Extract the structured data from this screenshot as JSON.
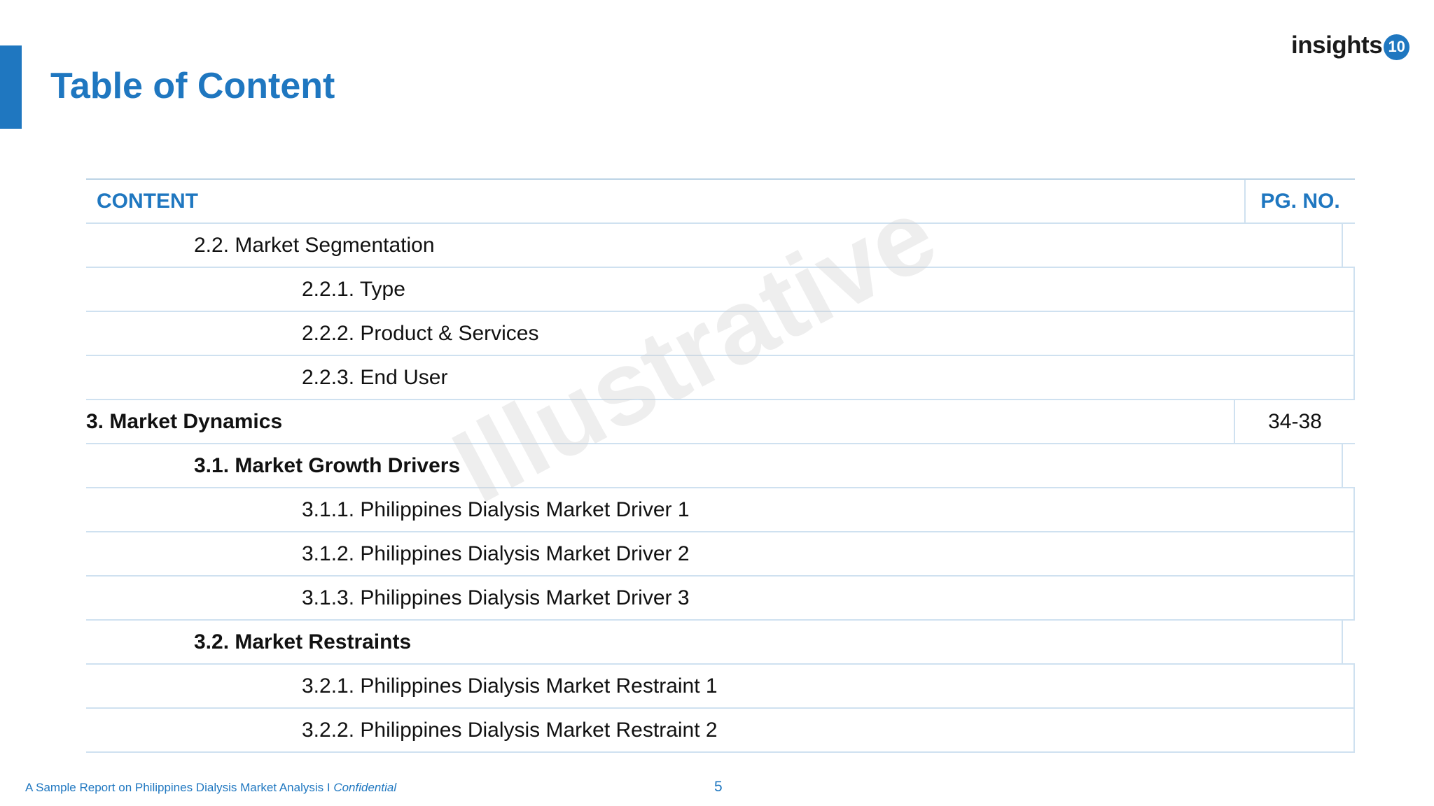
{
  "page": {
    "title": "Table of Content",
    "logo_text": "insights",
    "logo_badge": "10",
    "watermark": "Illustrative"
  },
  "table": {
    "header": {
      "content": "CONTENT",
      "page": "PG. NO."
    },
    "rows": [
      {
        "text": "2.2. Market Segmentation",
        "page": ""
      },
      {
        "text": "2.2.1. Type",
        "page": ""
      },
      {
        "text": "2.2.2. Product & Services",
        "page": ""
      },
      {
        "text": "2.2.3. End User",
        "page": ""
      },
      {
        "text": "3. Market Dynamics",
        "page": "34-38"
      },
      {
        "text": "3.1. Market Growth Drivers",
        "page": ""
      },
      {
        "text": "3.1.1. Philippines Dialysis Market Driver 1",
        "page": ""
      },
      {
        "text": "3.1.2. Philippines Dialysis Market Driver 2",
        "page": ""
      },
      {
        "text": "3.1.3. Philippines Dialysis Market Driver 3",
        "page": ""
      },
      {
        "text": "3.2. Market Restraints",
        "page": ""
      },
      {
        "text": "3.2.1. Philippines Dialysis Market Restraint 1",
        "page": ""
      },
      {
        "text": "3.2.2. Philippines Dialysis Market Restraint 2",
        "page": ""
      }
    ]
  },
  "footer": {
    "text": "A Sample Report on Philippines Dialysis Market Analysis I ",
    "confidential": "Confidential",
    "page_number": "5"
  },
  "colors": {
    "accent": "#1f77c0",
    "grid_line": "#cfe1f0"
  }
}
